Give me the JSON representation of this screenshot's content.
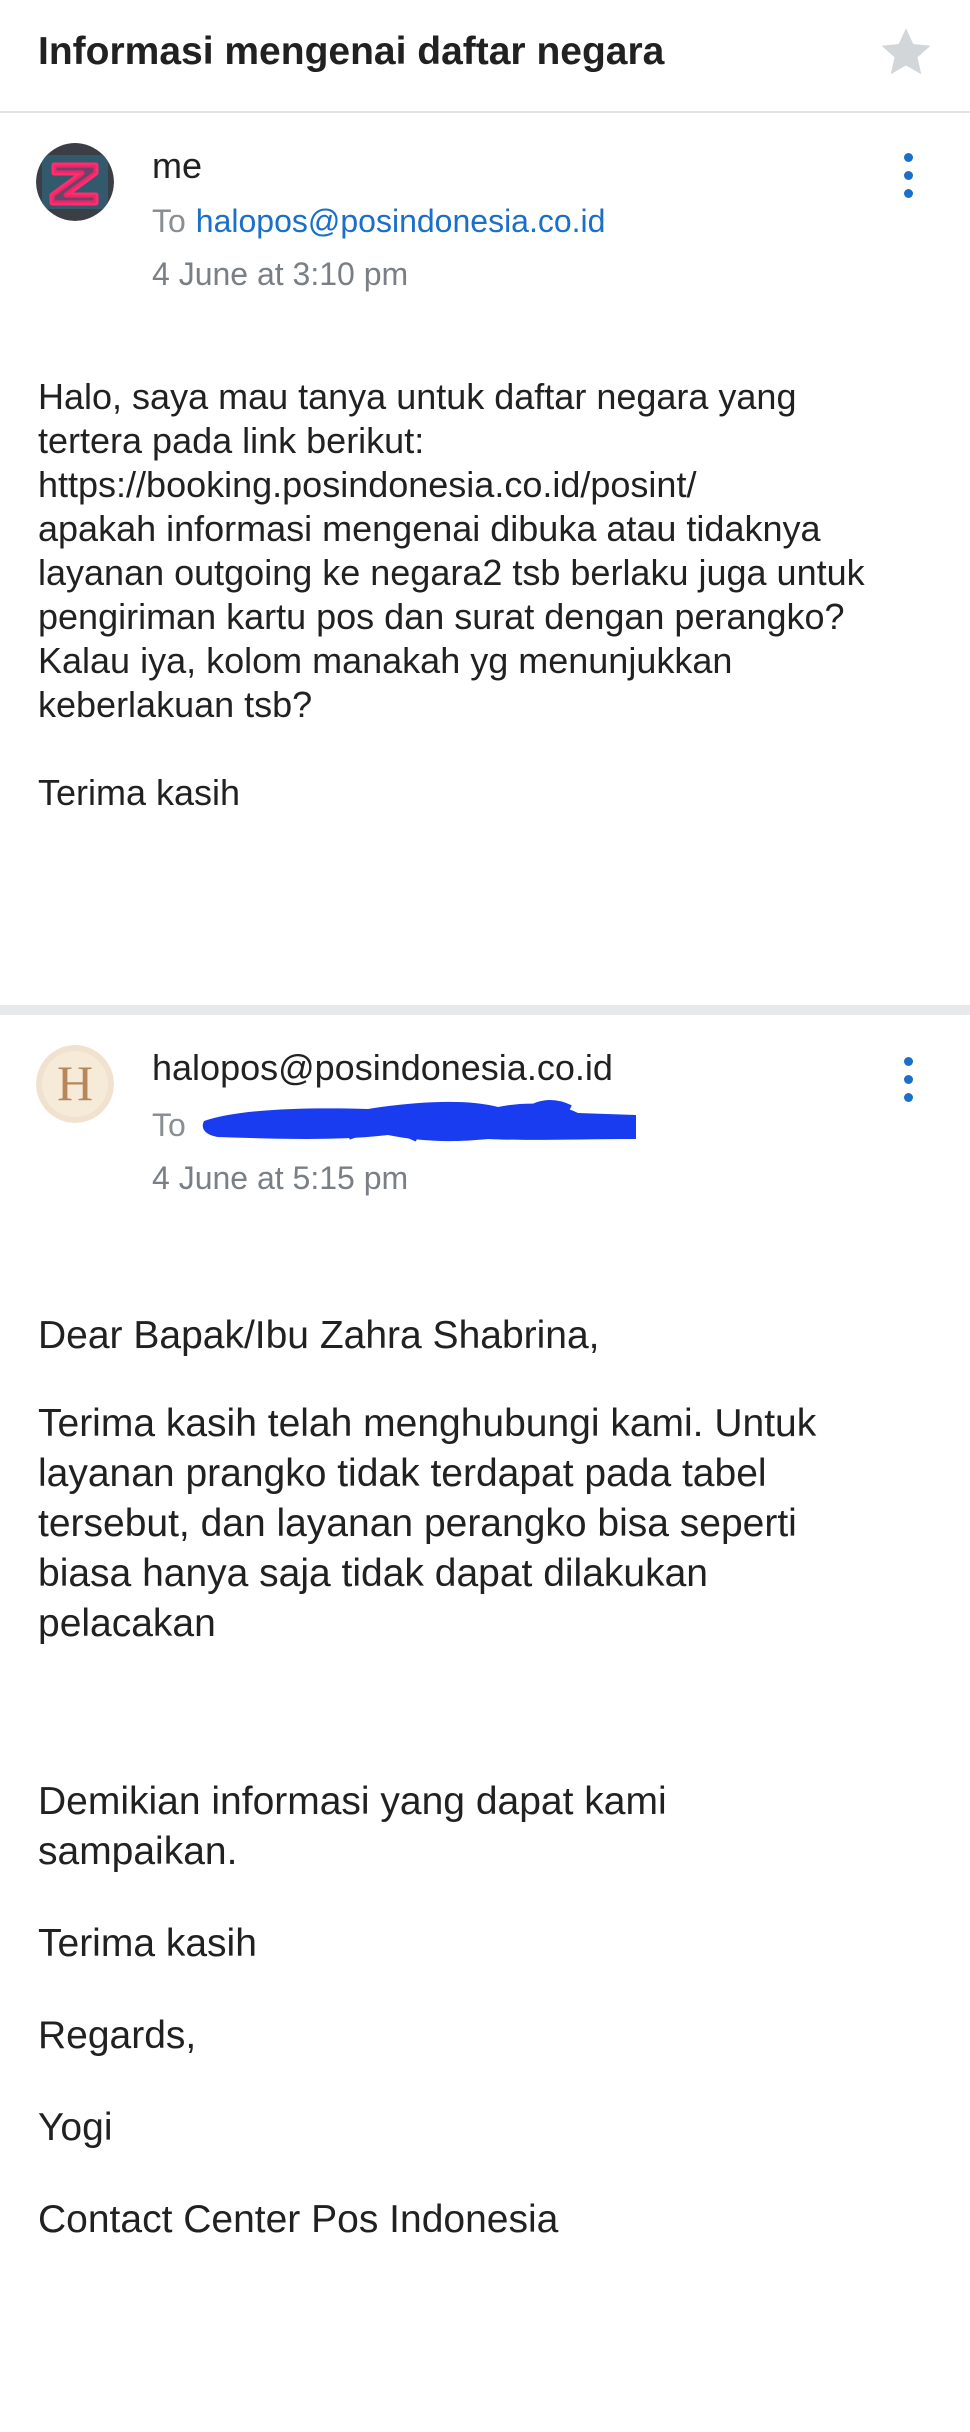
{
  "header": {
    "subject": "Informasi mengenai daftar negara",
    "star_icon": "star-icon"
  },
  "colors": {
    "link": "#1a6fc8",
    "redaction": "#1a3cf0",
    "divider": "#e6e9ec",
    "star": "#d3d6d9"
  },
  "messages": [
    {
      "sender": "me",
      "to_label": "To",
      "to_address": "halopos@posindonesia.co.id",
      "date": "4 June at 3:10 pm",
      "avatar_icon": "letter-z-avatar",
      "more_icon": "more-vert-icon",
      "body": [
        "Halo, saya mau tanya untuk daftar negara yang",
        "tertera pada link berikut:",
        "https://booking.posindonesia.co.id/posint/",
        "apakah informasi mengenai dibuka atau tidaknya",
        "layanan outgoing ke negara2 tsb berlaku juga untuk",
        "pengiriman kartu pos dan surat dengan perangko?",
        "Kalau iya, kolom manakah yg menunjukkan",
        "keberlakuan tsb?",
        "",
        "Terima kasih"
      ]
    },
    {
      "sender": "halopos@posindonesia.co.id",
      "to_label": "To",
      "to_address": "",
      "date": "4 June at 5:15 pm",
      "avatar_icon": "letter-h-avatar",
      "more_icon": "more-vert-icon",
      "body": [
        "Dear Bapak/Ibu Zahra Shabrina,",
        "",
        "Terima kasih telah menghubungi kami. Untuk",
        "layanan prangko tidak terdapat pada tabel",
        "tersebut, dan layanan perangko bisa seperti",
        "biasa hanya saja tidak dapat dilakukan",
        "pelacakan",
        "",
        "",
        "",
        "Demikian informasi yang dapat kami",
        "sampaikan.",
        "",
        "Terima kasih",
        "",
        "Regards,",
        "",
        "Yogi",
        "",
        "Contact Center Pos Indonesia"
      ]
    }
  ]
}
